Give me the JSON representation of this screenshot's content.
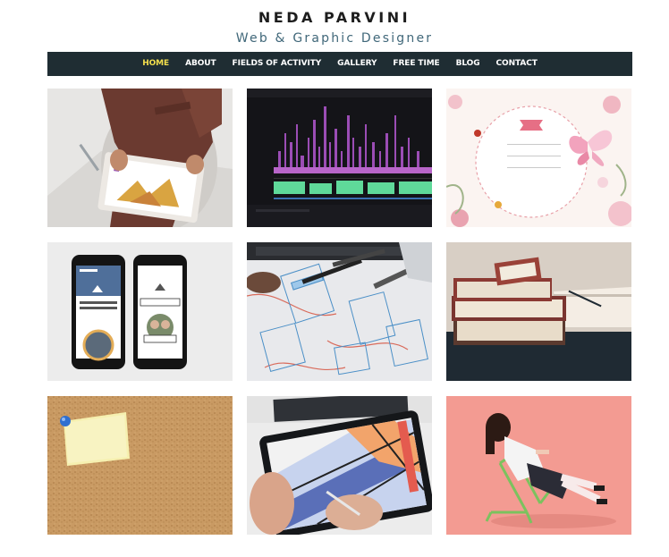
{
  "site": {
    "title": "NEDA PARVINI",
    "subtitle": "Web & Graphic Designer"
  },
  "nav": {
    "items": [
      {
        "label": "HOME",
        "active": true
      },
      {
        "label": "ABOUT"
      },
      {
        "label": "FIELDS OF ACTIVITY"
      },
      {
        "label": "GALLERY"
      },
      {
        "label": "FREE TIME"
      },
      {
        "label": "BLOG"
      },
      {
        "label": "CONTACT"
      }
    ]
  },
  "gallery": {
    "tiles": [
      {
        "subject": "tablet-design"
      },
      {
        "subject": "video-editing"
      },
      {
        "subject": "floral-card"
      },
      {
        "subject": "mobile-app-mockup",
        "texts": [
          "YOUR LUXURY WINTER ESCAPE",
          "ABOUT US",
          "WHO WE ARE"
        ]
      },
      {
        "subject": "wireframe-sketches"
      },
      {
        "subject": "books-and-pen"
      },
      {
        "subject": "corkboard-note"
      },
      {
        "subject": "tablet-drawing"
      },
      {
        "subject": "girl-on-chair"
      }
    ]
  },
  "colors": {
    "nav_bg": "#1f2d33",
    "nav_active": "#f4df4d",
    "subtitle": "#41687a"
  }
}
